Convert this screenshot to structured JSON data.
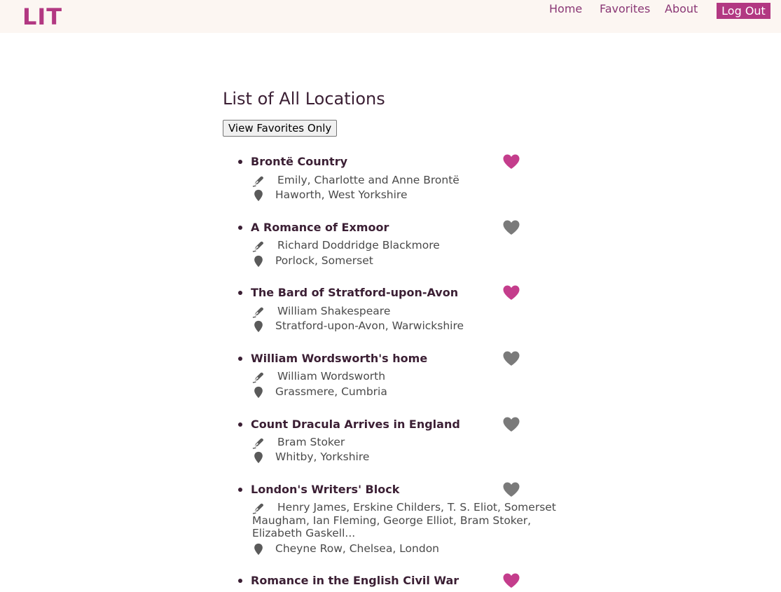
{
  "nav": {
    "logo": "LIT",
    "links": [
      {
        "label": "Home"
      },
      {
        "label": "Favorites"
      },
      {
        "label": "About"
      }
    ],
    "logout_label": "Log Out"
  },
  "main": {
    "title": "List of All Locations",
    "view_favorites_label": "View Favorites Only"
  },
  "colors": {
    "brand": "#b23882",
    "favorite_on": "#c43d8c",
    "favorite_off": "#7a7a7a",
    "nav_bg": "#fcf6f2"
  },
  "locations": [
    {
      "title": "Brontë Country",
      "author": "Emily, Charlotte and Anne Brontë",
      "place": "Haworth, West Yorkshire",
      "favorite": true
    },
    {
      "title": "A Romance of Exmoor",
      "author": "Richard Doddridge Blackmore",
      "place": "Porlock, Somerset",
      "favorite": false
    },
    {
      "title": "The Bard of Stratford-upon-Avon",
      "author": "William Shakespeare",
      "place": "Stratford-upon-Avon, Warwickshire",
      "favorite": true
    },
    {
      "title": "William Wordsworth's home",
      "author": "William Wordsworth",
      "place": "Grassmere, Cumbria",
      "favorite": false
    },
    {
      "title": "Count Dracula Arrives in England",
      "author": "Bram Stoker",
      "place": "Whitby, Yorkshire",
      "favorite": false
    },
    {
      "title": "London's Writers' Block",
      "author": "Henry James, Erskine Childers, T. S. Eliot, Somerset Maugham, Ian Fleming, George Elliot, Bram Stoker, Elizabeth Gaskell...",
      "place": "Cheyne Row, Chelsea, London",
      "favorite": false
    },
    {
      "title": "Romance in the English Civil War",
      "author": "",
      "place": "",
      "favorite": true
    }
  ]
}
